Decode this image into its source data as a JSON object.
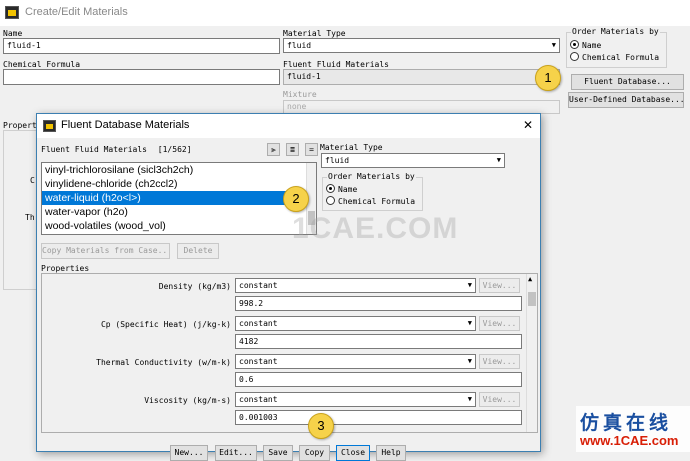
{
  "main_window": {
    "title": "Create/Edit Materials",
    "name_label": "Name",
    "name_value": "fluid-1",
    "chemical_formula_label": "Chemical Formula",
    "chemical_formula_value": "",
    "material_type_label": "Material Type",
    "material_type_value": "fluid",
    "fluent_fluid_materials_label": "Fluent Fluid Materials",
    "fluent_fluid_materials_value": "fluid-1",
    "mixture_label": "Mixture",
    "mixture_value": "none",
    "order_label": "Order Materials by",
    "order_options": [
      "Name",
      "Chemical Formula"
    ],
    "fluent_database_button": "Fluent Database...",
    "user_defined_database_button": "User-Defined Database...",
    "properties_label_partial": "Propert",
    "prop_partial_1": "C",
    "prop_partial_2": "Th"
  },
  "dialog": {
    "title": "Fluent Database Materials",
    "close_glyph": "✕",
    "list_label": "Fluent Fluid Materials",
    "list_count": "[1/562]",
    "materials": [
      "vinyl-trichlorosilane (sicl3ch2ch)",
      "vinylidene-chloride (ch2ccl2)",
      "water-liquid (h2o<l>)",
      "water-vapor (h2o)",
      "wood-volatiles (wood_vol)"
    ],
    "selected_index": 2,
    "material_type_label": "Material Type",
    "material_type_value": "fluid",
    "order_label": "Order Materials by",
    "order_options": [
      "Name",
      "Chemical Formula"
    ],
    "copy_button": "Copy Materials from Case...",
    "delete_button": "Delete",
    "properties_label": "Properties",
    "properties": [
      {
        "label": "Density (kg/m3)",
        "method": "constant",
        "value": "998.2"
      },
      {
        "label": "Cp (Specific Heat) (j/kg-k)",
        "method": "constant",
        "value": "4182"
      },
      {
        "label": "Thermal Conductivity (w/m-k)",
        "method": "constant",
        "value": "0.6"
      },
      {
        "label": "Viscosity (kg/m-s)",
        "method": "constant",
        "value": "0.001003"
      }
    ],
    "view_button": "View...",
    "bottom_buttons": [
      "New...",
      "Edit...",
      "Save",
      "Copy",
      "Close",
      "Help"
    ]
  },
  "callouts": [
    "1",
    "2",
    "3"
  ],
  "watermark": "1CAE.COM",
  "brand": {
    "chinese": "仿真在线",
    "url": "www.1CAE.com"
  },
  "colors": {
    "selection": "#0078d7",
    "callout": "#f6d24a",
    "brand_blue": "#1a4fa0",
    "brand_red": "#d81e06"
  }
}
